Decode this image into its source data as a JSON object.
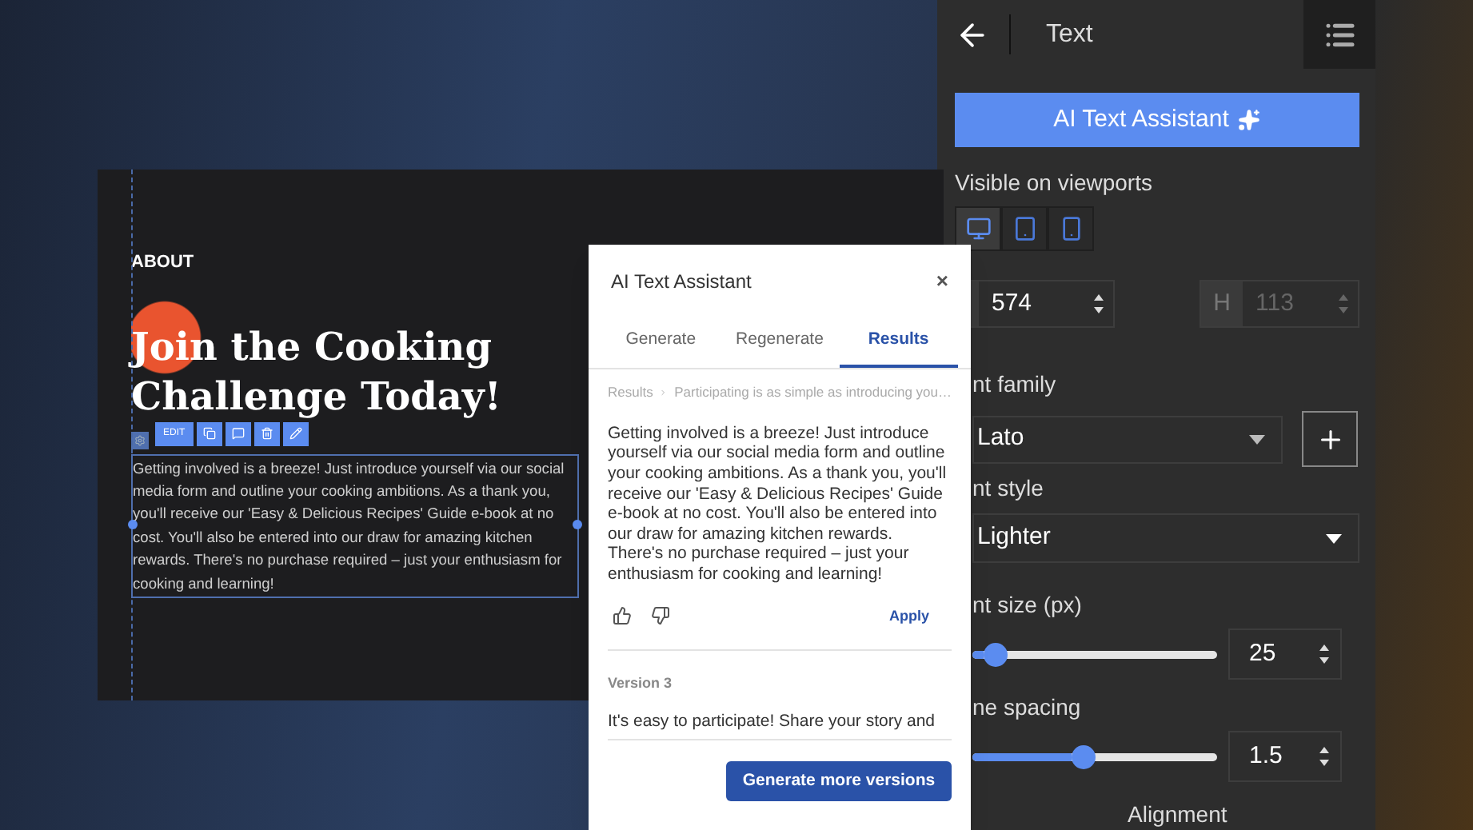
{
  "canvas": {
    "section_label": "ABOUT",
    "heading": "Join the Cooking Challenge Today!",
    "toolbar": {
      "edit_label": "EDIT"
    },
    "paragraph": "Getting involved is a breeze! Just introduce yourself via our social media form and outline your cooking ambitions. As a thank you, you'll receive our 'Easy & Delicious Recipes' Guide e-book at no cost. You'll also be entered into our draw for amazing kitchen rewards. There's no purchase required – just your enthusiasm for cooking and learning!"
  },
  "dialog": {
    "title": "AI Text Assistant",
    "close": "×",
    "tabs": [
      {
        "label": "Generate",
        "selected": false
      },
      {
        "label": "Regenerate",
        "selected": false
      },
      {
        "label": "Results",
        "selected": true
      }
    ],
    "breadcrumb": [
      "Results",
      "Participating is as simple as introducing you…"
    ],
    "result_text": "Getting involved is a breeze! Just introduce yourself via our social media form and outline your cooking ambitions. As a thank you, you'll receive our 'Easy & Delicious Recipes' Guide e-book at no cost. You'll also be entered into our draw for amazing kitchen rewards. There's no purchase required – just your enthusiasm for cooking and learning!",
    "apply": "Apply",
    "version_label": "Version 3",
    "version_text": "It's easy to participate! Share your story and",
    "generate_button": "Generate more versions"
  },
  "panel": {
    "title": "Text",
    "assistant_button": "AI Text Assistant",
    "viewports_label": "Visible on viewports",
    "viewports": [
      {
        "kind": "desktop",
        "selected": true
      },
      {
        "kind": "tablet",
        "selected": false
      },
      {
        "kind": "mobile",
        "selected": false
      }
    ],
    "width": {
      "value": "574",
      "disabled": false
    },
    "height": {
      "label": "H",
      "value": "113",
      "disabled": true
    },
    "font_family_label": "nt family",
    "font_family": "Lato",
    "font_style_label": "nt style",
    "font_style": "Lighter",
    "font_size_label": "nt size (px)",
    "font_size": {
      "level": 0.05,
      "value": "25"
    },
    "line_spacing_label": "ne spacing",
    "line_spacing": {
      "level": 0.45,
      "value": "1.5"
    },
    "alignment_label": "Alignment"
  }
}
